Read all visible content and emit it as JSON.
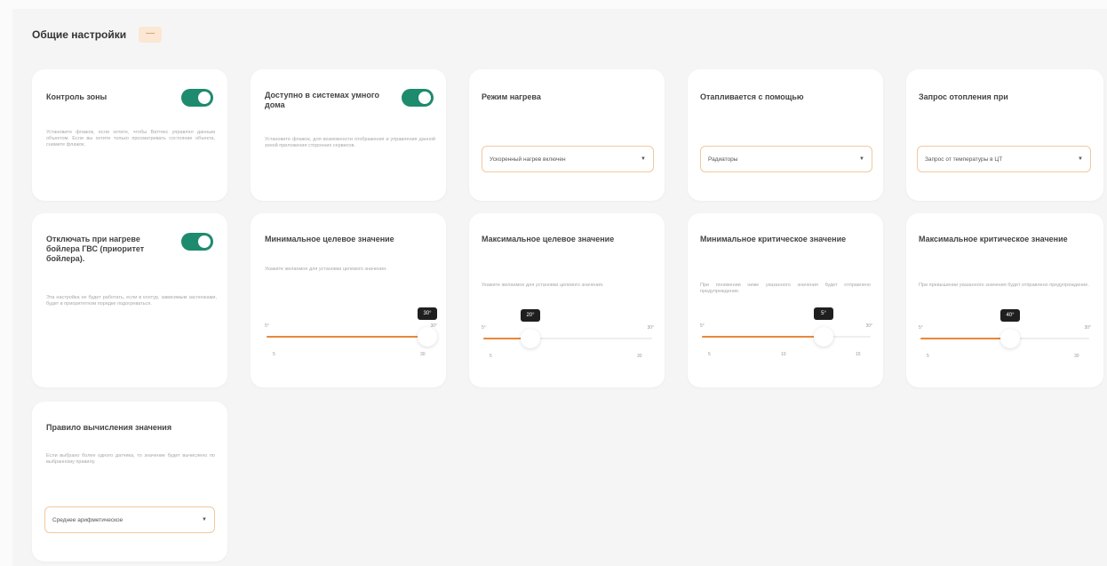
{
  "header": {
    "title": "Общие настройки",
    "collapse_icon": "chevron-up-icon",
    "collapse_label": "—"
  },
  "colors": {
    "accent": "#e8883a",
    "toggle_on": "#1e8a6e",
    "select_border": "#f0c9a0"
  },
  "cards": {
    "zone_control": {
      "title": "Контроль зоны",
      "desc": "Установите флажок, если хотите, чтобы Ваттекс управлял данным объектом. Если вы хотите только просматривать состояние объекта, снимите флажок.",
      "toggle_on": true
    },
    "smart_home": {
      "title": "Доступно в системах умного дома",
      "desc": "Установите флажок, для возможности отображения и управления данной зоной приложения сторонних сервисов.",
      "toggle_on": true
    },
    "heating_mode": {
      "title": "Режим нагрева",
      "select_value": "Ускоренный нагрев включен"
    },
    "heated_by": {
      "title": "Отапливается с помощью",
      "select_value": "Радиаторы"
    },
    "heat_request": {
      "title": "Запрос отопления при",
      "select_value": "Запрос от температуры в ЦТ"
    },
    "boiler_disable": {
      "title": "Отключать при нагреве бойлера ГВС (приоритет бойлера).",
      "desc": "Эта настройка не будет работать, если в контур, зависимым заслонками, будет в приоритетном порядке подогреваться.",
      "toggle_on": true
    },
    "min_target": {
      "title": "Минимальное целевое значение",
      "desc": "Укажите желаемое для установки целевого значения.",
      "range_min": "5°",
      "range_max": "30°",
      "tick_min": "5",
      "tick_max": "30",
      "value_label": "30°",
      "fraction": 0.95
    },
    "max_target": {
      "title": "Максимальное целевое значение",
      "desc": "Укажите желаемое для установки целевого значения.",
      "range_min": "5°",
      "range_max": "30°",
      "tick_min": "5",
      "tick_max": "30",
      "value_label": "20°",
      "fraction": 0.28
    },
    "min_critical": {
      "title": "Минимальное критическое значение",
      "desc": "При понижении ниже указанного значения будет отправлено предупреждение.",
      "range_min": "5°",
      "range_max": "30°",
      "tick_min": "5",
      "tick_mid": "10",
      "tick_max": "15",
      "value_label": "5°",
      "fraction": 0.72
    },
    "max_critical": {
      "title": "Максимальное критическое значение",
      "desc": "При превышении указанного значения будет отправлено предупреждение.",
      "range_min": "5°",
      "range_max": "30°",
      "tick_min": "5",
      "tick_max": "30",
      "value_label": "40°",
      "fraction": 0.53
    },
    "calc_rule": {
      "title": "Правило вычисления значения",
      "desc": "Если выбрано более одного датчика, то значение будет вычислено по выбранному правилу.",
      "select_value": "Среднее арифметическое"
    }
  }
}
